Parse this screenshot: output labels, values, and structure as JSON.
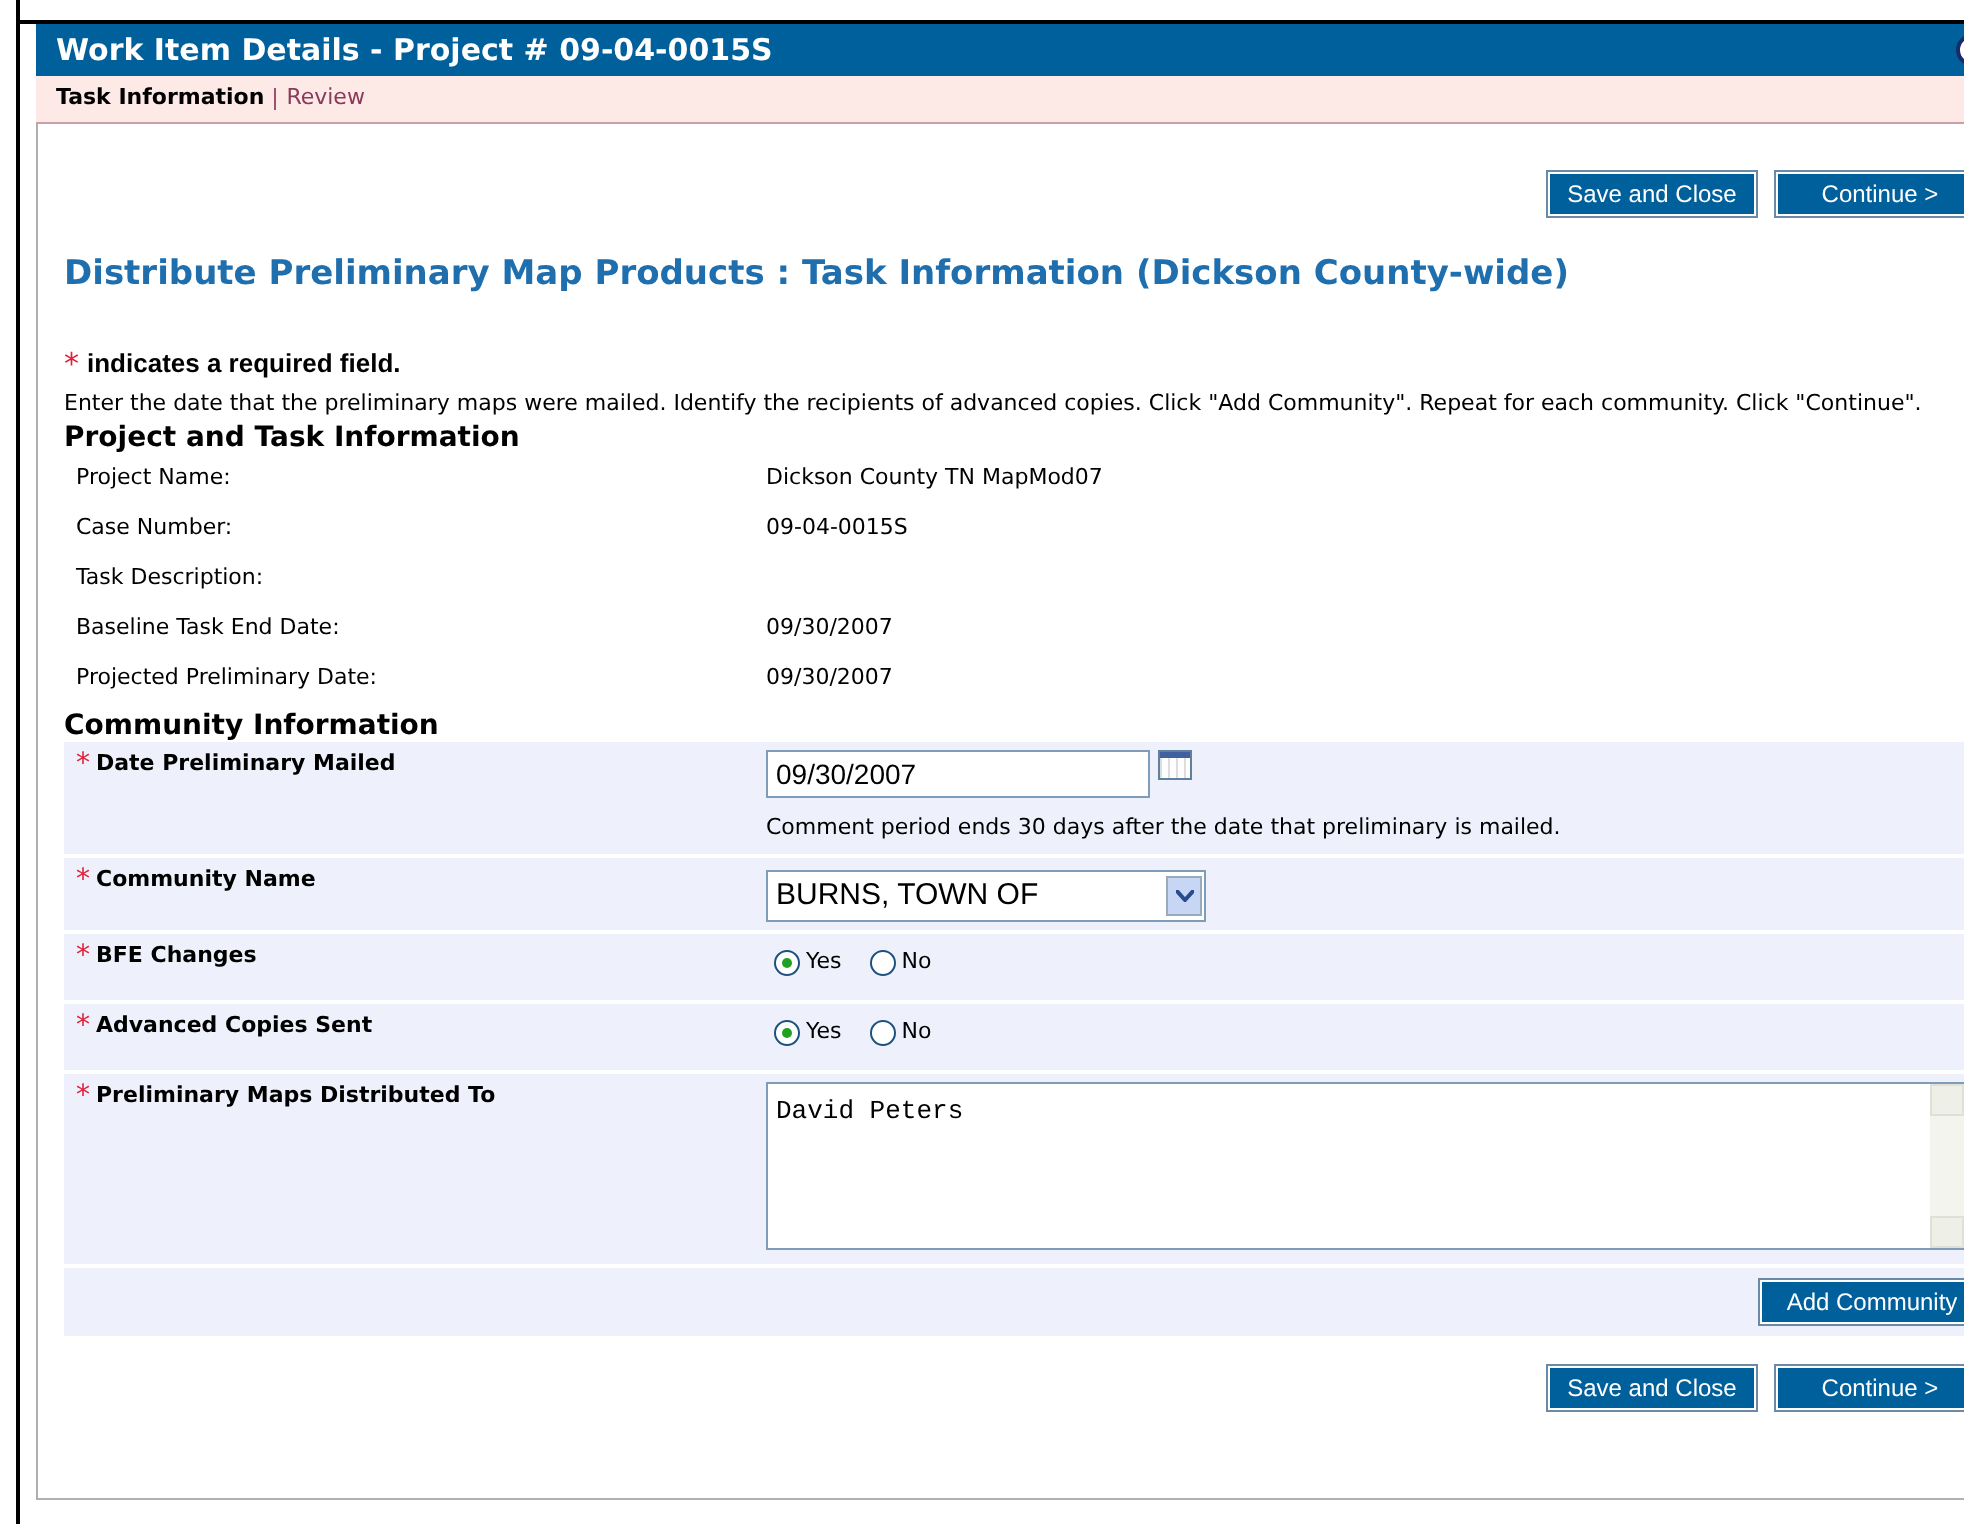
{
  "window": {
    "title": "Work Item Details - Project # 09-04-0015S"
  },
  "tabs": [
    {
      "label": "Task Information",
      "selected": true
    },
    {
      "label": "Review",
      "selected": false
    }
  ],
  "top_buttons": [
    "Save and Close",
    "Continue >"
  ],
  "heading": "Distribute Preliminary Map Products : Task Information (Dickson County-wide)",
  "required_note": {
    "mark": "*",
    "text": "indicates a required field."
  },
  "instructions": "Enter the date that the preliminary maps were mailed. Identify the recipients of advanced copies. Click \"Add Community\". Repeat for each community. Click \"Continue\".",
  "project_section": {
    "title": "Project and Task Information",
    "rows": [
      {
        "label": "Project Name:",
        "value": "Dickson County TN MapMod07"
      },
      {
        "label": "Case Number:",
        "value": "09-04-0015S"
      },
      {
        "label": "Task Description:"
      },
      {
        "label": "Baseline Task End Date:",
        "value": "09/30/2007"
      },
      {
        "label": "Projected Preliminary Date:",
        "value": "09/30/2007"
      }
    ]
  },
  "community_section": {
    "title": "Community Information",
    "fields": [
      {
        "kind": "date",
        "mark": "*",
        "label": "Date Preliminary Mailed",
        "value": "09/30/2007",
        "note": "Comment period ends 30 days after the date that preliminary is mailed."
      },
      {
        "kind": "select",
        "mark": "*",
        "label": "Community Name",
        "value": "BURNS, TOWN OF"
      },
      {
        "kind": "radio",
        "mark": "*",
        "label": "BFE Changes",
        "options": [
          {
            "label": "Yes",
            "selected": true
          },
          {
            "label": "No",
            "selected": false
          }
        ]
      },
      {
        "kind": "radio",
        "mark": "*",
        "label": "Advanced Copies Sent",
        "options": [
          {
            "label": "Yes",
            "selected": true
          },
          {
            "label": "No",
            "selected": false
          }
        ]
      },
      {
        "kind": "textarea",
        "mark": "*",
        "label": "Preliminary Maps Distributed To",
        "value": "David Peters"
      }
    ],
    "add_button": "Add Community"
  },
  "bottom_buttons": [
    "Save and Close",
    "Continue >"
  ]
}
